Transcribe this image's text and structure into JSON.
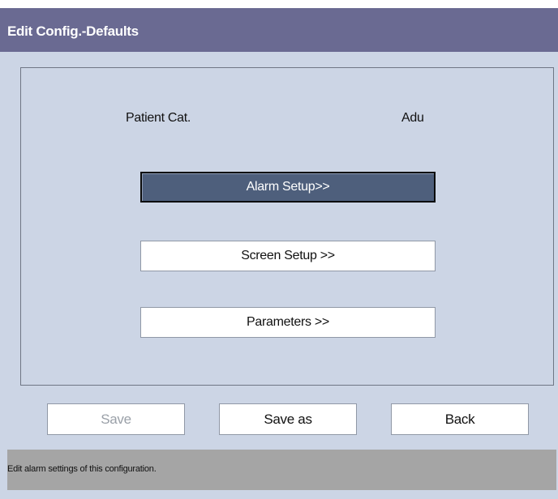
{
  "window": {
    "title": "Edit Config.-Defaults"
  },
  "patient": {
    "label": "Patient Cat.",
    "value": "Adu"
  },
  "menu": {
    "alarm_setup": "Alarm Setup>>",
    "screen_setup": "Screen Setup >>",
    "parameters": "Parameters >>"
  },
  "actions": {
    "save": "Save",
    "save_as": "Save as",
    "back": "Back"
  },
  "status": {
    "message": "Edit alarm settings of this configuration."
  },
  "colors": {
    "titlebar": "#6a6a92",
    "background": "#ccd5e5",
    "active_button": "#4e5f7c",
    "statusbar": "#a5a5a5"
  }
}
